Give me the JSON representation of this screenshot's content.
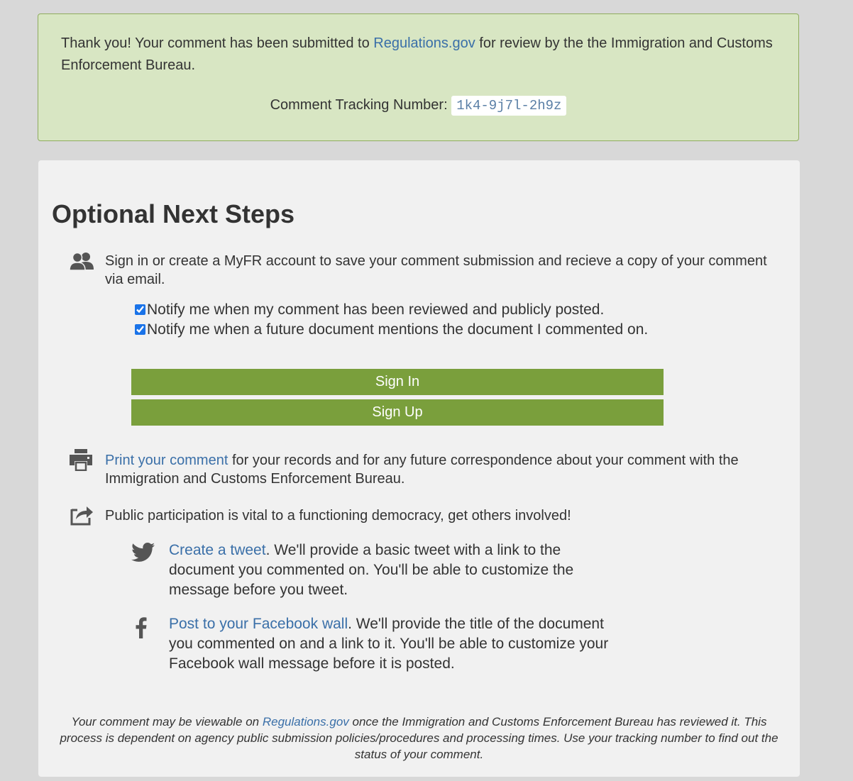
{
  "success": {
    "text_before_link": "Thank you! Your comment has been submitted to ",
    "link": "Regulations.gov",
    "text_after_link": " for review by the the Immigration and Customs Enforcement Bureau.",
    "tracking_label": "Comment Tracking Number:",
    "tracking_number": "1k4-9j7l-2h9z"
  },
  "steps": {
    "title": "Optional Next Steps",
    "account": {
      "icon": "users-icon",
      "text": "Sign in or create a MyFR account to save your comment submission and recieve a copy of your comment via email.",
      "checkboxes": [
        {
          "label": "Notify me when my comment has been reviewed and publicly posted.",
          "checked": true
        },
        {
          "label": "Notify me when a future document mentions the document I commented on.",
          "checked": true
        }
      ],
      "sign_in_label": "Sign In",
      "sign_up_label": "Sign Up"
    },
    "print": {
      "icon": "print-icon",
      "link": "Print your comment",
      "text": " for your records and for any future correspondence about your comment with the Immigration and Customs Enforcement Bureau."
    },
    "share": {
      "icon": "share-icon",
      "text": "Public participation is vital to a functioning democracy, get others involved!",
      "twitter": {
        "icon": "twitter-icon",
        "link": "Create a tweet",
        "text": ". We'll provide a basic tweet with a link to the document you commented on. You'll be able to customize the message before you tweet."
      },
      "facebook": {
        "icon": "facebook-icon",
        "link": "Post to your Facebook wall",
        "text": ". We'll provide the title of the document you commented on and a link to it. You'll be able to customize your Facebook wall message before it is posted."
      }
    },
    "footer": {
      "before_link": "Your comment may be viewable on ",
      "link": "Regulations.gov",
      "after_link": " once the Immigration and Customs Enforcement Bureau has reviewed it. This process is dependent on agency public submission policies/procedures and processing times. Use your tracking number to find out the status of your comment."
    }
  },
  "colors": {
    "success_background": "#d8e6c3",
    "success_border": "#8fac5e",
    "button_green": "#7a9f3c",
    "link_blue": "#3a6fa8",
    "page_background": "#d8d8d8",
    "panel_background": "#f1f1f1"
  }
}
